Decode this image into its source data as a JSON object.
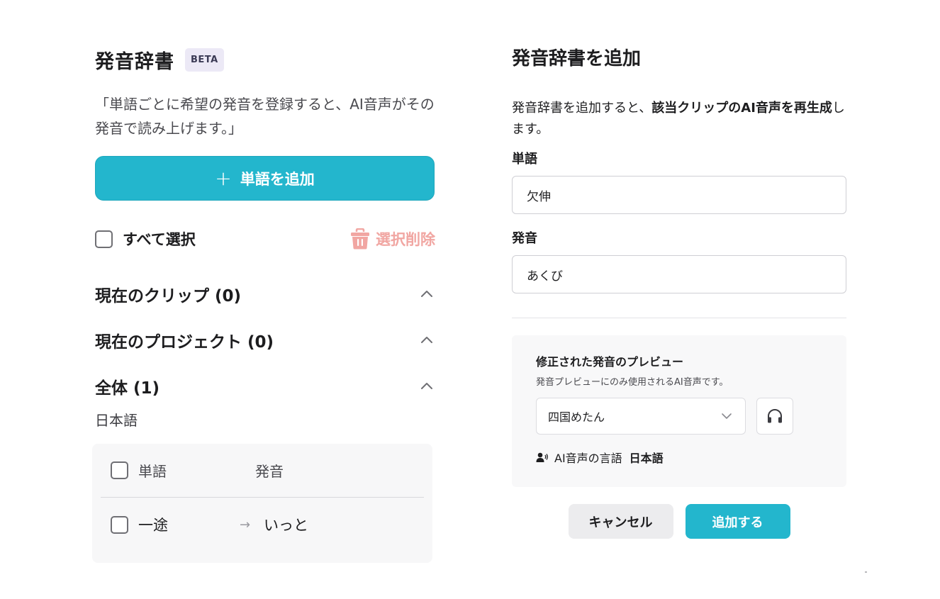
{
  "left_panel": {
    "title": "発音辞書",
    "badge": "BETA",
    "description": "「単語ごとに希望の発音を登録すると、AI音声がその発音で読み上げます。」",
    "add_word_plus": "+",
    "add_word_label": "単語を追加",
    "select_all_label": "すべて選択",
    "delete_selected_label": "選択削除",
    "sections": [
      {
        "label": "現在のクリップ (0)"
      },
      {
        "label": "現在のプロジェクト (0)"
      },
      {
        "label": "全体 (1)"
      }
    ],
    "language_label": "日本語",
    "table": {
      "headers": {
        "word": "単語",
        "pronunciation": "発音"
      },
      "rows": [
        {
          "word": "一途",
          "arrow": "→",
          "pronunciation": "いっと"
        }
      ]
    }
  },
  "right_panel": {
    "title": "発音辞書を追加",
    "description_part1": "発音辞書を追加すると、",
    "description_bold": "該当クリップのAI音声を再生成",
    "description_part2": "します。",
    "word_label": "単語",
    "word_value": "欠伸",
    "pronunciation_label": "発音",
    "pronunciation_value": "あくび",
    "preview": {
      "title": "修正された発音のプレビュー",
      "subtitle": "発音プレビューにのみ使用されるAI音声です。",
      "voice_selected": "四国めたん",
      "voice_lang_label": "AI音声の言語",
      "voice_lang_value": "日本語"
    },
    "cancel_label": "キャンセル",
    "submit_label": "追加する"
  },
  "icons": {
    "plus": "plus-icon",
    "trash": "trash-icon",
    "chevron_up": "chevron-up-icon",
    "chevron_down": "chevron-down-icon",
    "headphones": "headphones-icon",
    "speaker_person": "voice-speaker-icon",
    "arrow": "arrow-right-icon"
  },
  "colors": {
    "accent": "#23b6cd",
    "delete_disabled": "#f1a6a2",
    "badge_bg": "#ece9f6"
  }
}
